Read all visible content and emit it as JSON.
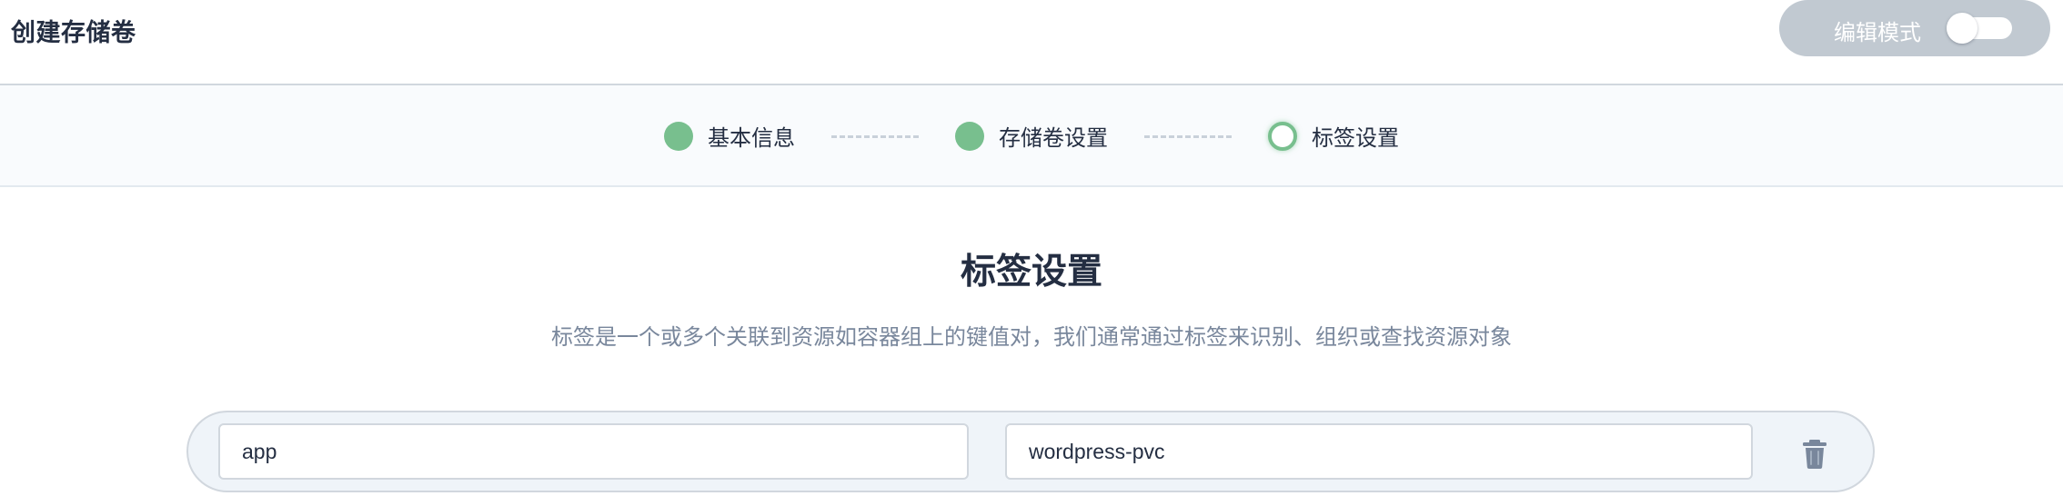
{
  "header": {
    "title": "创建存储卷",
    "edit_mode_label": "编辑模式",
    "edit_mode_on": false
  },
  "steps": [
    {
      "label": "基本信息",
      "state": "done"
    },
    {
      "label": "存储卷设置",
      "state": "done"
    },
    {
      "label": "标签设置",
      "state": "current"
    }
  ],
  "section": {
    "title": "标签设置",
    "description": "标签是一个或多个关联到资源如容器组上的键值对，我们通常通过标签来识别、组织或查找资源对象"
  },
  "labels": [
    {
      "key": "app",
      "value": "wordpress-pvc"
    }
  ],
  "colors": {
    "step_done": "#78bf8e",
    "edit_mode_bg": "#c1c9d1",
    "row_bg": "#eff4f9"
  },
  "icons": {
    "delete": "trash-icon",
    "toggle": "toggle-switch"
  }
}
